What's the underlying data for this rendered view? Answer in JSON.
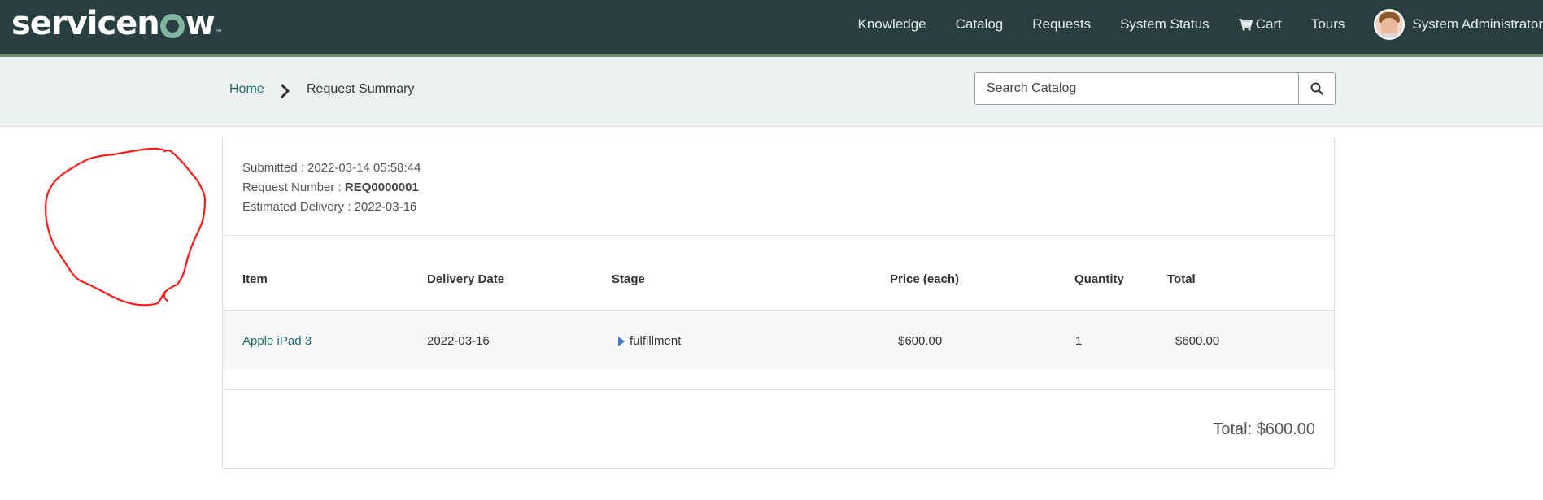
{
  "header": {
    "logo_text_before": "servicen",
    "logo_text_after": "w",
    "logo_tm": "™",
    "nav": {
      "knowledge": "Knowledge",
      "catalog": "Catalog",
      "requests": "Requests",
      "system_status": "System Status",
      "cart": "Cart",
      "tours": "Tours"
    },
    "user_name": "System Administrator"
  },
  "breadcrumb": {
    "home": "Home",
    "current": "Request Summary"
  },
  "search": {
    "placeholder": "Search Catalog"
  },
  "summary": {
    "submitted_label": "Submitted : ",
    "submitted_value": "2022-03-14 05:58:44",
    "request_number_label": "Request Number : ",
    "request_number_value": "REQ0000001",
    "estimated_delivery_label": "Estimated Delivery : ",
    "estimated_delivery_value": "2022-03-16"
  },
  "table": {
    "headers": {
      "item": "Item",
      "delivery_date": "Delivery Date",
      "stage": "Stage",
      "price": "Price (each)",
      "quantity": "Quantity",
      "total": "Total"
    },
    "rows": [
      {
        "item": "Apple iPad 3",
        "delivery_date": "2022-03-16",
        "stage": "fulfillment",
        "price": "$600.00",
        "quantity": "1",
        "total": "$600.00"
      }
    ]
  },
  "grand_total": "Total: $600.00",
  "colors": {
    "header_bg": "#293e40",
    "header_accent": "#6d9070",
    "link": "#1f6f70",
    "annotation": "#ff0000"
  }
}
